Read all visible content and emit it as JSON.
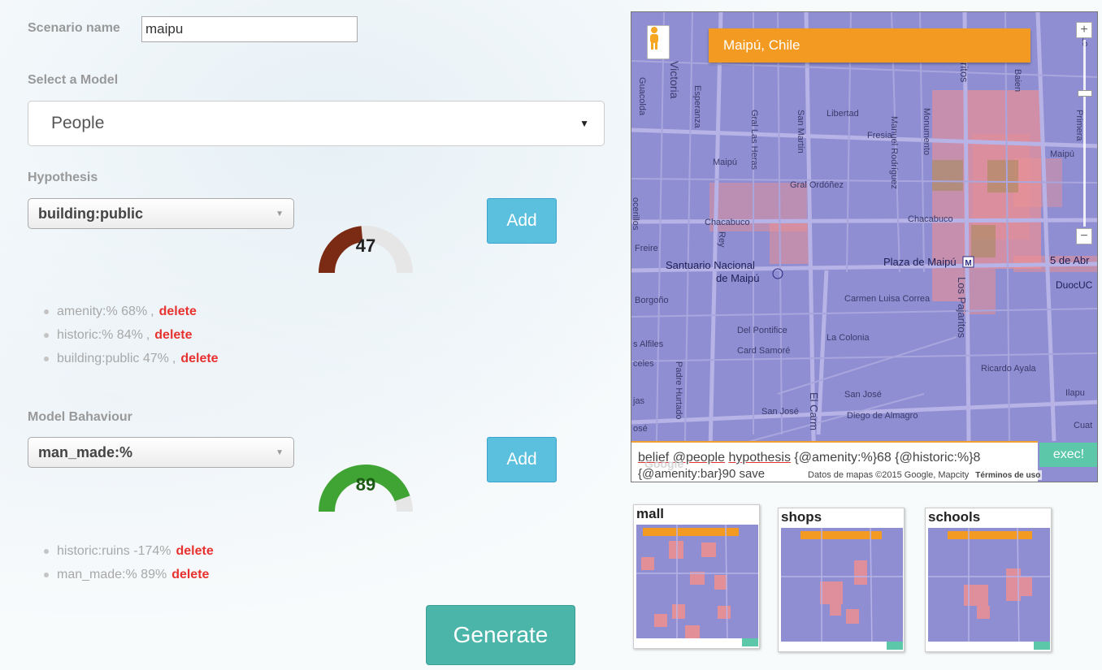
{
  "scenario": {
    "label": "Scenario name",
    "value": "maipu"
  },
  "model": {
    "label": "Select a Model",
    "selected": "People"
  },
  "hypothesis": {
    "label": "Hypothesis",
    "selected": "building:public",
    "add_label": "Add",
    "gauge": {
      "value": "47",
      "fraction": 0.47,
      "color": "#7b2a13"
    },
    "items": [
      {
        "text": "amenity:% 68%",
        "sep": ",",
        "delete": "delete"
      },
      {
        "text": "historic:% 84%",
        "sep": ",",
        "delete": "delete"
      },
      {
        "text": "building:public 47%",
        "sep": ",",
        "delete": "delete"
      }
    ]
  },
  "behaviour": {
    "label": "Model Bahaviour",
    "selected": "man_made:%",
    "add_label": "Add",
    "gauge": {
      "value": "89",
      "fraction": 0.89,
      "color": "#3fa433"
    },
    "items": [
      {
        "text": "historic:ruins -174%",
        "sep": "",
        "delete": "delete"
      },
      {
        "text": "man_made:% 89%",
        "sep": "",
        "delete": "delete"
      }
    ]
  },
  "generate_label": "Generate",
  "map": {
    "title": "Maipú, Chile",
    "zoom_in": "+",
    "zoom_out": "−",
    "console_line1": {
      "a": "belief",
      "b": "@people",
      "c": "hypothesis",
      "d": "{@amenity:%}68  {@historic:%}8"
    },
    "console_line2": "{@amenity:bar}90  save",
    "exec_label": "exec!",
    "logo": "Google",
    "credit": "Datos de mapas ©2015 Google, Mapcity",
    "terms": "Términos de uso",
    "street_labels": {
      "victoria": "Victoria",
      "guacolda": "Guacolda",
      "esperanza": "Esperanza",
      "gral_las_heras": "Gral Las Heras",
      "san_martin": "San Martín",
      "libertad": "Libertad",
      "fresia": "Fresia",
      "manuel_rodriguez": "Manuel Rodríguez",
      "monumento": "Monumento",
      "los_pajaritos_top": "ritos",
      "baien": "Baien",
      "primera": "Primera",
      "maipu": "Maipú",
      "gral_ordonez": "Gral Ordóñez",
      "chacabuco_1": "Chacabuco",
      "chacabuco_2": "Chacabuco",
      "maipu_right": "Maipú",
      "freire": "Freire",
      "rey": "Rey",
      "santuario_1": "Santuario Nacional",
      "santuario_2": "de Maipú",
      "plaza": "Plaza de Maipú",
      "cinco_abril": "5 de Abr",
      "duoc": "DuocUC",
      "borgono": "Borgoño",
      "carmen": "Carmen Luisa Correa",
      "los_pajaritos": "Los Pajaritos",
      "del_pontifice": "Del Pontifice",
      "la_colonia": "La Colonia",
      "card_samore": "Card Samoré",
      "los_alfiles": "s Alfiles",
      "celes": "celes",
      "ricardo": "Ricardo Ayala",
      "padre": "Padre Hurtado",
      "san_jose_1": "San José",
      "san_jose_2": "San José",
      "el_carmen": "El Carm",
      "diego": "Diego de Almagro",
      "ilapu": "Ilapu",
      "cuat": "Cuat",
      "jas": "jas",
      "ose": "osé",
      "ocerillos": "ocerillos",
      "lo": "Lo"
    }
  },
  "thumbnails": [
    {
      "label": "mall"
    },
    {
      "label": "shops"
    },
    {
      "label": "schools"
    }
  ]
}
